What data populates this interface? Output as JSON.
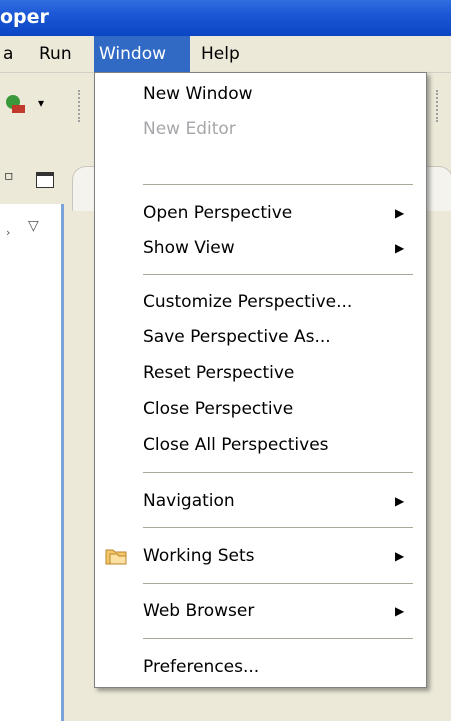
{
  "window": {
    "title_fragment": "oper"
  },
  "menubar": {
    "items": [
      {
        "label": "a"
      },
      {
        "label": "Run"
      },
      {
        "label": "Window"
      },
      {
        "label": "Help"
      }
    ]
  },
  "window_menu": {
    "items": [
      {
        "label": "New Window",
        "enabled": true,
        "submenu": false
      },
      {
        "label": "New Editor",
        "enabled": false,
        "submenu": false
      },
      {
        "label": "Open Perspective",
        "enabled": true,
        "submenu": true
      },
      {
        "label": "Show View",
        "enabled": true,
        "submenu": true
      },
      {
        "label": "Customize Perspective...",
        "enabled": true,
        "submenu": false
      },
      {
        "label": "Save Perspective As...",
        "enabled": true,
        "submenu": false
      },
      {
        "label": "Reset Perspective",
        "enabled": true,
        "submenu": false
      },
      {
        "label": "Close Perspective",
        "enabled": true,
        "submenu": false
      },
      {
        "label": "Close All Perspectives",
        "enabled": true,
        "submenu": false
      },
      {
        "label": "Navigation",
        "enabled": true,
        "submenu": true
      },
      {
        "label": "Working Sets",
        "enabled": true,
        "submenu": true,
        "icon": "folder-working-sets-icon"
      },
      {
        "label": "Web Browser",
        "enabled": true,
        "submenu": true
      },
      {
        "label": "Preferences...",
        "enabled": true,
        "submenu": false
      }
    ]
  },
  "icons": {
    "submenu_arrow": "triangle-right-icon",
    "view_menu": "chevron-down-icon",
    "maximize": "maximize-icon",
    "toolbar_run": "run-tool-icon"
  },
  "colors": {
    "titlebar": "#0a46c4",
    "menu_highlight": "#316ac5",
    "disabled_text": "#a7a6aa",
    "view_border": "#7aa4d9"
  }
}
